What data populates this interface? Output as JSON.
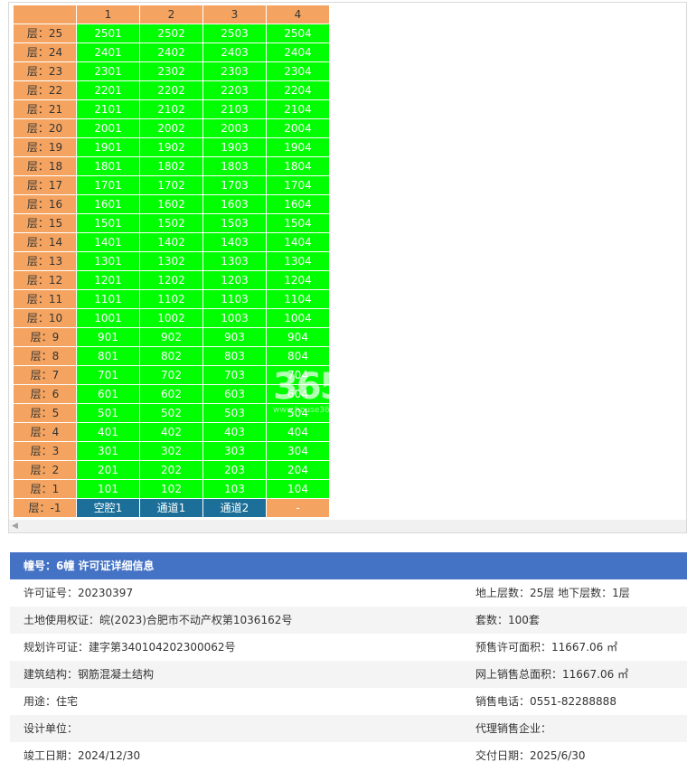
{
  "grid": {
    "columns": [
      "",
      "1",
      "2",
      "3",
      "4"
    ],
    "rows": [
      {
        "floor": "层：25",
        "units": [
          "2501",
          "2502",
          "2503",
          "2504"
        ]
      },
      {
        "floor": "层：24",
        "units": [
          "2401",
          "2402",
          "2403",
          "2404"
        ]
      },
      {
        "floor": "层：23",
        "units": [
          "2301",
          "2302",
          "2303",
          "2304"
        ]
      },
      {
        "floor": "层：22",
        "units": [
          "2201",
          "2202",
          "2203",
          "2204"
        ]
      },
      {
        "floor": "层：21",
        "units": [
          "2101",
          "2102",
          "2103",
          "2104"
        ]
      },
      {
        "floor": "层：20",
        "units": [
          "2001",
          "2002",
          "2003",
          "2004"
        ]
      },
      {
        "floor": "层：19",
        "units": [
          "1901",
          "1902",
          "1903",
          "1904"
        ]
      },
      {
        "floor": "层：18",
        "units": [
          "1801",
          "1802",
          "1803",
          "1804"
        ]
      },
      {
        "floor": "层：17",
        "units": [
          "1701",
          "1702",
          "1703",
          "1704"
        ]
      },
      {
        "floor": "层：16",
        "units": [
          "1601",
          "1602",
          "1603",
          "1604"
        ]
      },
      {
        "floor": "层：15",
        "units": [
          "1501",
          "1502",
          "1503",
          "1504"
        ]
      },
      {
        "floor": "层：14",
        "units": [
          "1401",
          "1402",
          "1403",
          "1404"
        ]
      },
      {
        "floor": "层：13",
        "units": [
          "1301",
          "1302",
          "1303",
          "1304"
        ]
      },
      {
        "floor": "层：12",
        "units": [
          "1201",
          "1202",
          "1203",
          "1204"
        ]
      },
      {
        "floor": "层：11",
        "units": [
          "1101",
          "1102",
          "1103",
          "1104"
        ]
      },
      {
        "floor": "层：10",
        "units": [
          "1001",
          "1002",
          "1003",
          "1004"
        ]
      },
      {
        "floor": "层：9",
        "units": [
          "901",
          "902",
          "903",
          "904"
        ]
      },
      {
        "floor": "层：8",
        "units": [
          "801",
          "802",
          "803",
          "804"
        ]
      },
      {
        "floor": "层：7",
        "units": [
          "701",
          "702",
          "703",
          "704"
        ]
      },
      {
        "floor": "层：6",
        "units": [
          "601",
          "602",
          "603",
          "604"
        ]
      },
      {
        "floor": "层：5",
        "units": [
          "501",
          "502",
          "503",
          "504"
        ]
      },
      {
        "floor": "层：4",
        "units": [
          "401",
          "402",
          "403",
          "404"
        ]
      },
      {
        "floor": "层：3",
        "units": [
          "301",
          "302",
          "303",
          "304"
        ]
      },
      {
        "floor": "层：2",
        "units": [
          "201",
          "202",
          "203",
          "204"
        ]
      },
      {
        "floor": "层：1",
        "units": [
          "101",
          "102",
          "103",
          "104"
        ]
      }
    ],
    "basement": {
      "floor": "层：-1",
      "units": [
        "空腔1",
        "通道1",
        "通道2",
        "-"
      ]
    },
    "colors": {
      "header": "#f4a460",
      "available": "#00ff00",
      "special": "#1b6f98"
    },
    "watermark": {
      "big": "365",
      "small": "www.house365"
    }
  },
  "detail": {
    "title": "幢号：6幢 许可证详细信息",
    "rows": [
      {
        "left": "许可证号：20230397",
        "right": "地上层数：25层  地下层数：1层"
      },
      {
        "left": "土地使用权证：皖(2023)合肥市不动产权第1036162号",
        "right": "套数：100套"
      },
      {
        "left": "规划许可证：建字第340104202300062号",
        "right": "预售许可面积：11667.06 ㎡"
      },
      {
        "left": "建筑结构：钢筋混凝土结构",
        "right": "网上销售总面积：11667.06 ㎡"
      },
      {
        "left": "用途：住宅",
        "right": "销售电话：0551-82288888"
      },
      {
        "left": "设计单位：",
        "right": "代理销售企业："
      },
      {
        "left": "竣工日期：2024/12/30",
        "right": "交付日期：2025/6/30"
      }
    ]
  }
}
